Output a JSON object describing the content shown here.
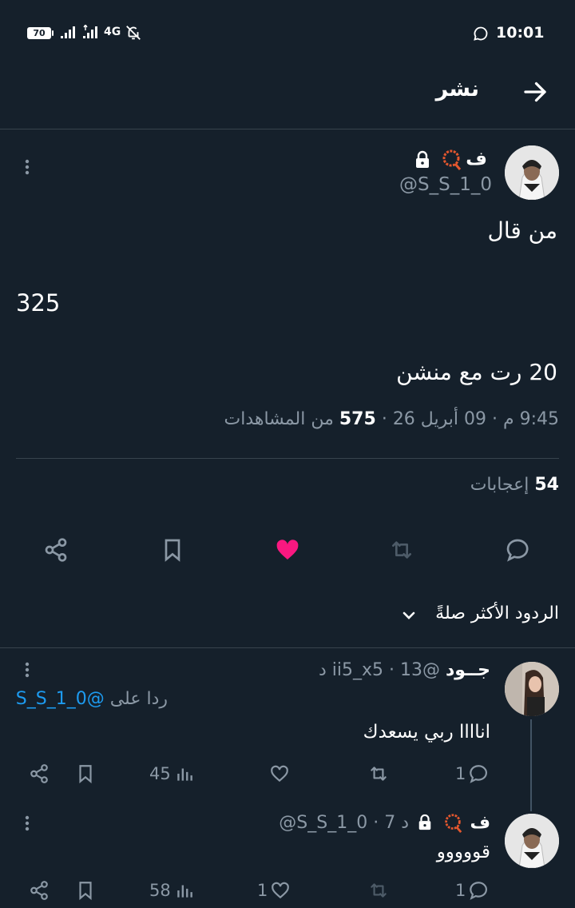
{
  "status_bar": {
    "battery": "70",
    "network": "4G",
    "time": "10:01"
  },
  "header": {
    "title": "نشر",
    "back_icon": "arrow-right-icon"
  },
  "tweet": {
    "display_name": "ف",
    "handle": "@S_S_1_0",
    "body_line1": "من قال",
    "body_number": "325",
    "body_line3": "20 رت مع منشن",
    "meta_time": "9:45 م",
    "meta_sep1": "·",
    "meta_date": "09 أبريل 26",
    "meta_sep2": "·",
    "meta_views_count": "575",
    "meta_views_label": "من المشاهدات",
    "likes_count": "54",
    "likes_label": "إعجابات",
    "liked_color": "#f91880"
  },
  "replies_sort": {
    "label": "الردود الأكثر صلةً"
  },
  "replies": [
    {
      "display_name": "جــود",
      "handle": "@ii5_x5",
      "time": "13 د",
      "sep": "·",
      "replying_to_prefix": "ردا على",
      "replying_to_handle": "@S_S_1_0",
      "text": "اناااا ربي يسعدك",
      "reply_count": "1",
      "retweet_count": "",
      "like_count": "",
      "views_count": "45"
    },
    {
      "display_name": "ف",
      "handle": "@S_S_1_0",
      "time": "7 د",
      "sep": "·",
      "text": "قووووو",
      "reply_count": "1",
      "retweet_count": "",
      "like_count": "1",
      "views_count": "58"
    }
  ]
}
